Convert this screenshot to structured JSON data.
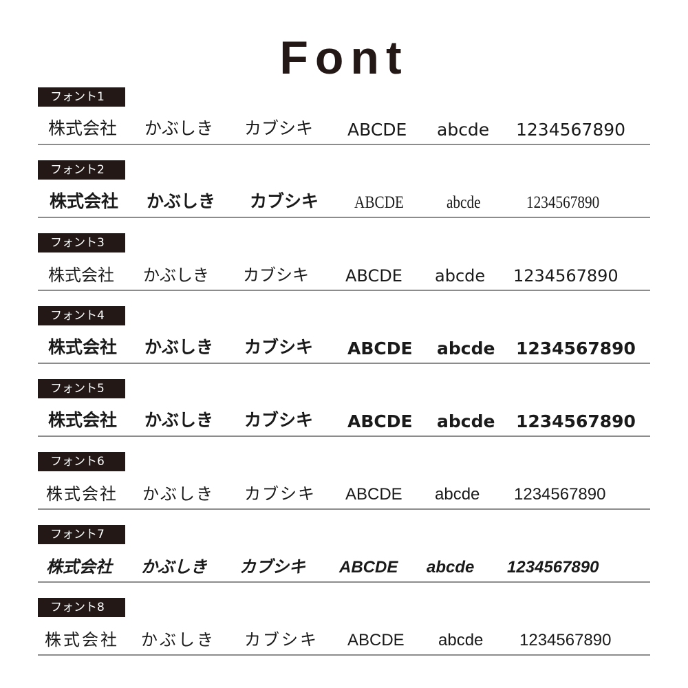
{
  "title": "Font",
  "samples": {
    "kanji": "株式会社",
    "hiragana": "かぶしき",
    "katakana": "カブシキ",
    "upper": "ABCDE",
    "lower": "abcde",
    "digits": "1234567890"
  },
  "fonts": [
    {
      "label": "フォント1"
    },
    {
      "label": "フォント2"
    },
    {
      "label": "フォント3"
    },
    {
      "label": "フォント4"
    },
    {
      "label": "フォント5"
    },
    {
      "label": "フォント6"
    },
    {
      "label": "フォント7"
    },
    {
      "label": "フォント8"
    }
  ],
  "colors": {
    "label_bg": "#231815",
    "label_text": "#ffffff",
    "rule": "#8c8c8c",
    "title": "#231815"
  }
}
